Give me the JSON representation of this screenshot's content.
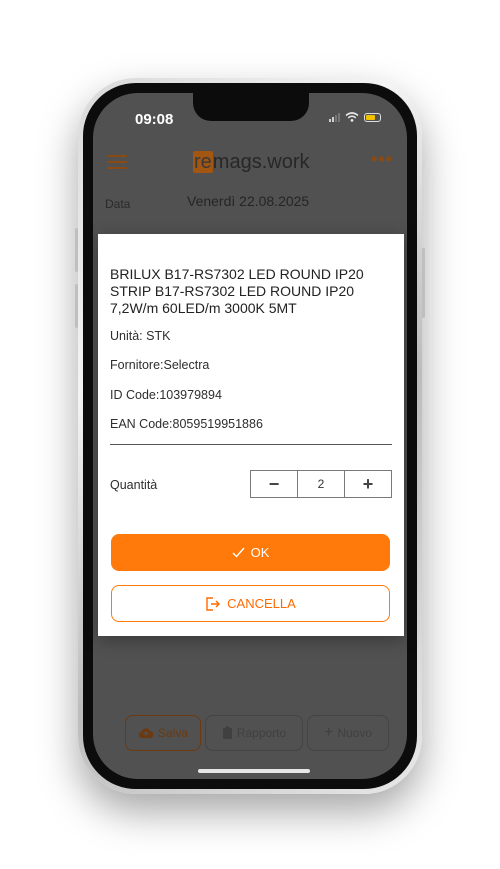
{
  "status_bar": {
    "time": "09:08"
  },
  "app_bar": {
    "logo_prefix": "re",
    "logo_rest": "mags.work",
    "more": "•••"
  },
  "form": {
    "date_label": "Data",
    "date_value": "Venerdì 22.08.2025"
  },
  "modal": {
    "title": "BRILUX B17-RS7302 LED ROUND IP20 STRIP B17-RS7302 LED ROUND IP20 7,2W/m 60LED/m 3000K 5MT",
    "unit": "Unità: STK",
    "supplier": "Fornitore:Selectra",
    "id_code": "ID Code:103979894",
    "ean_code": "EAN Code:8059519951886",
    "quantity_label": "Quantità",
    "quantity_value": "2",
    "minus": "−",
    "plus": "+",
    "ok_label": "OK",
    "cancel_label": "CANCELLA"
  },
  "bottom_bar": {
    "save": "Salva",
    "report": "Rapporto",
    "new": "Nuovo"
  },
  "colors": {
    "accent": "#ff7a0b",
    "overlay": "#515151",
    "brand_dark": "#a35612"
  }
}
